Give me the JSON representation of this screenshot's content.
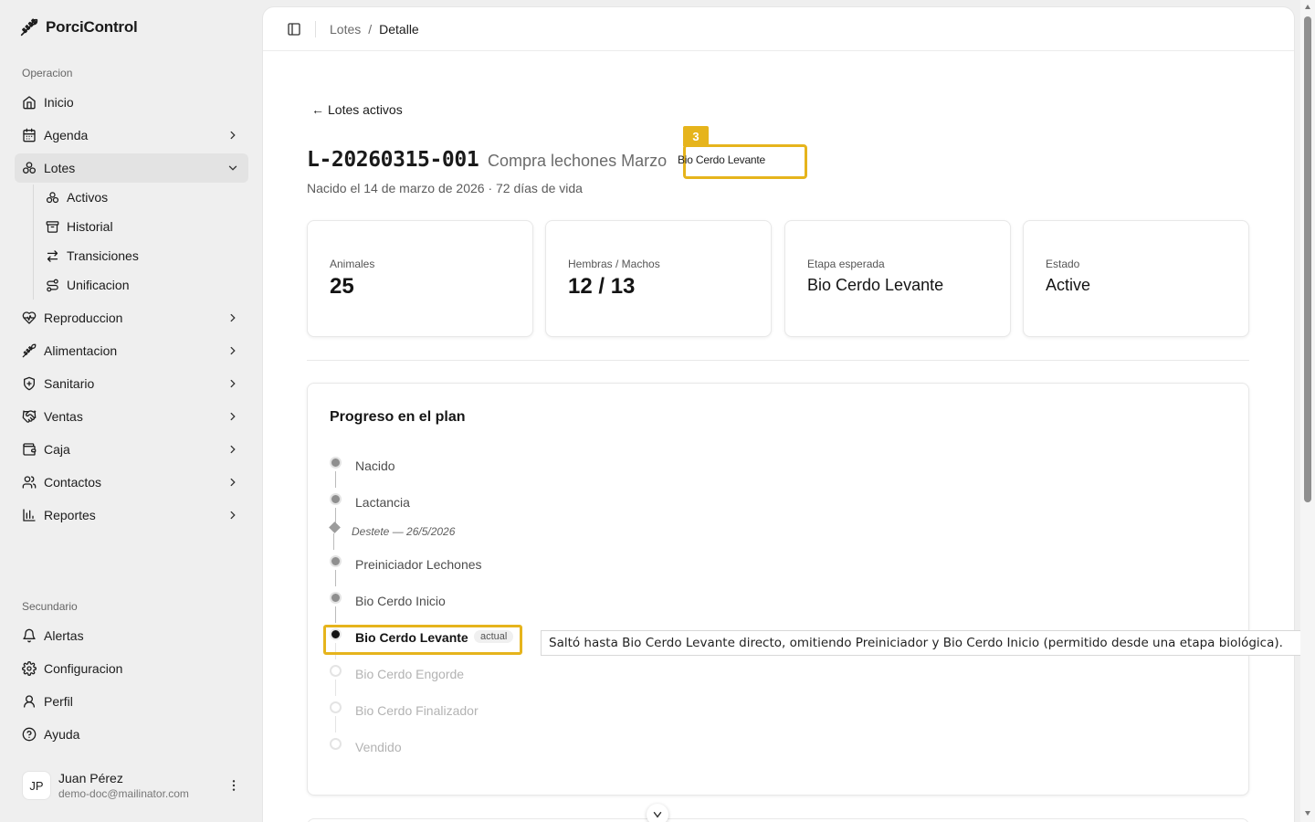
{
  "app": {
    "name": "PorciControl"
  },
  "sidebar": {
    "group_operacion": "Operacion",
    "group_secundario": "Secundario",
    "items": {
      "inicio": "Inicio",
      "agenda": "Agenda",
      "lotes": "Lotes",
      "activos": "Activos",
      "historial": "Historial",
      "transiciones": "Transiciones",
      "unificacion": "Unificacion",
      "reproduccion": "Reproduccion",
      "alimentacion": "Alimentacion",
      "sanitario": "Sanitario",
      "ventas": "Ventas",
      "caja": "Caja",
      "contactos": "Contactos",
      "reportes": "Reportes",
      "alertas": "Alertas",
      "configuracion": "Configuracion",
      "perfil": "Perfil",
      "ayuda": "Ayuda"
    },
    "user": {
      "initials": "JP",
      "name": "Juan Pérez",
      "email": "demo-doc@mailinator.com"
    }
  },
  "breadcrumb": {
    "parent": "Lotes",
    "separator": "/",
    "current": "Detalle"
  },
  "header": {
    "back_arrow": "←",
    "back_label": "Lotes activos",
    "code": "L-20260315-001",
    "name": "Compra lechones Marzo",
    "stage_badge": "Bio Cerdo Levante",
    "annotation_number": "3",
    "born": "Nacido el 14 de marzo de 2026 · 72 días de vida"
  },
  "stats": [
    {
      "label": "Animales",
      "value": "25"
    },
    {
      "label": "Hembras / Machos",
      "value": "12 / 13"
    },
    {
      "label": "Etapa esperada",
      "value": "Bio Cerdo Levante"
    },
    {
      "label": "Estado",
      "value": "Active"
    }
  ],
  "plan": {
    "title": "Progreso en el plan",
    "stages": {
      "nacido": "Nacido",
      "lactancia": "Lactancia",
      "destete_note": "Destete — 26/5/2026",
      "preiniciador": "Preiniciador Lechones",
      "bio_inicio": "Bio Cerdo Inicio",
      "bio_levante": "Bio Cerdo Levante",
      "actual_tag": "actual",
      "bio_engorde": "Bio Cerdo Engorde",
      "bio_finalizador": "Bio Cerdo Finalizador",
      "vendido": "Vendido"
    },
    "tooltip": "Saltó hasta Bio Cerdo Levante directo, omitiendo Preiniciador y Bio Cerdo Inicio (permitido desde una etapa biológica)."
  },
  "colors": {
    "highlight": "#e6b41c"
  }
}
